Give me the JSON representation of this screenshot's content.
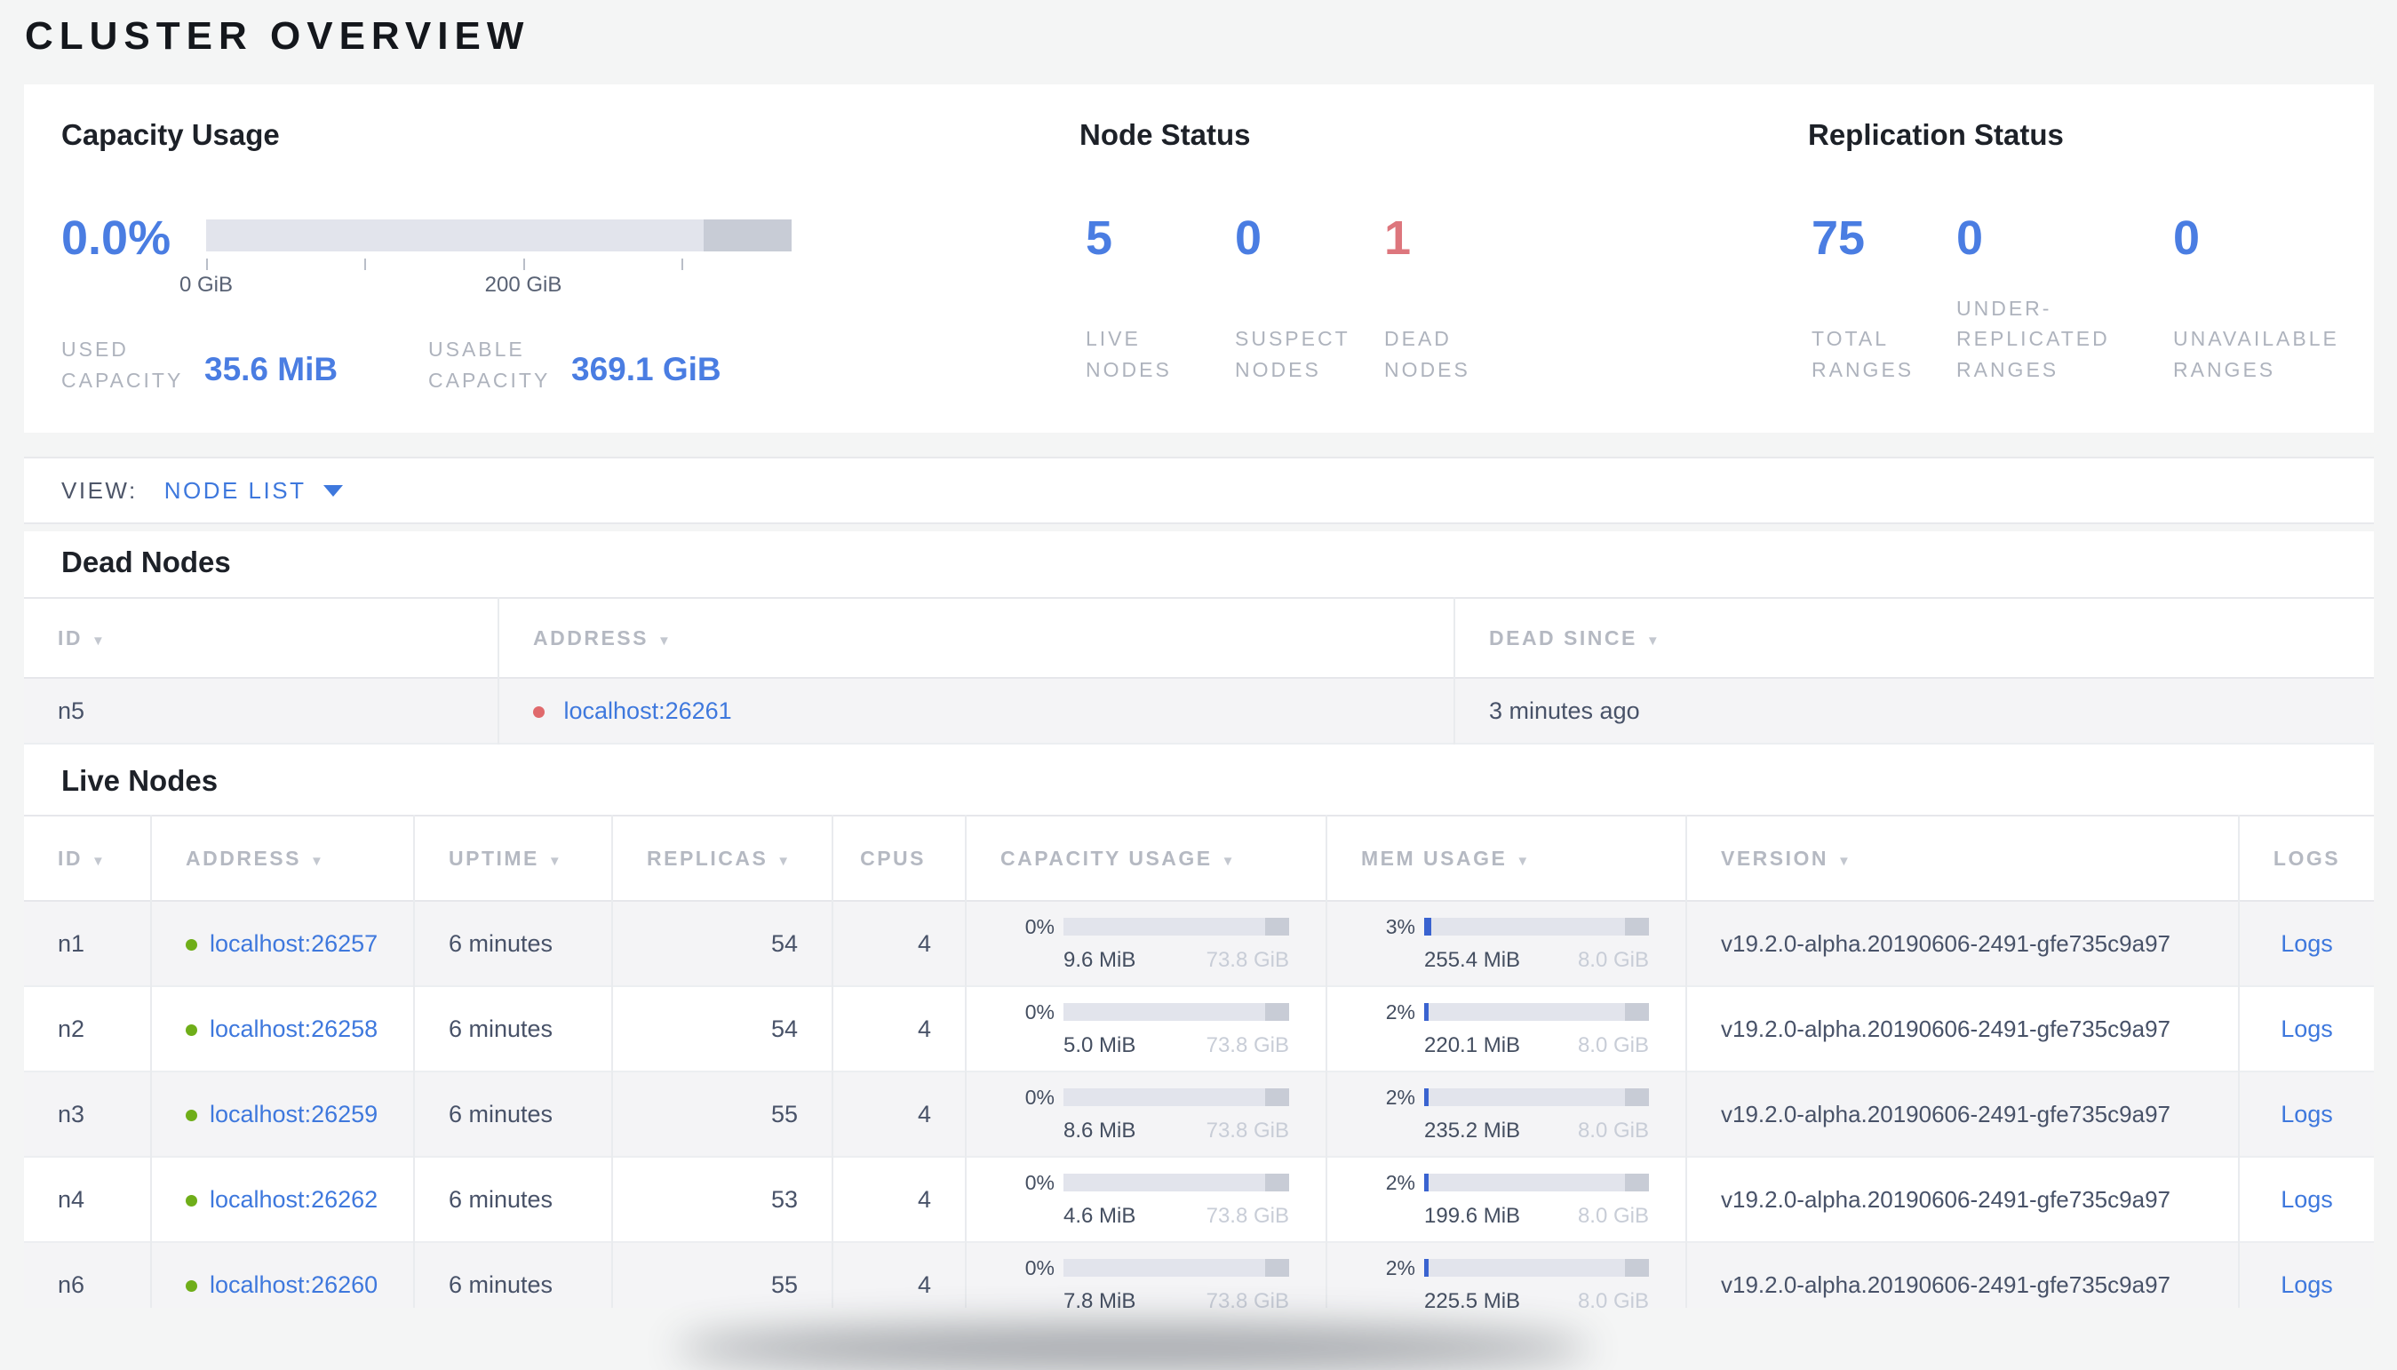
{
  "page_title": "CLUSTER OVERVIEW",
  "colors": {
    "accent_blue": "#3e78dd",
    "stat_blue": "#4a7de2",
    "dead_red": "#dd767d",
    "dead_dot": "#e0696c",
    "live_green": "#6fae19",
    "mem_fill": "#3a63d0"
  },
  "overview": {
    "capacity": {
      "title": "Capacity Usage",
      "percent": "0.0%",
      "tick_labels": [
        "0 GiB",
        "200 GiB"
      ],
      "used_label": "USED CAPACITY",
      "used_value": "35.6 MiB",
      "usable_label": "USABLE CAPACITY",
      "usable_value": "369.1 GiB"
    },
    "node_status": {
      "title": "Node Status",
      "stats": [
        {
          "value": "5",
          "label": "LIVE NODES"
        },
        {
          "value": "0",
          "label": "SUSPECT NODES"
        },
        {
          "value": "1",
          "label": "DEAD NODES"
        }
      ]
    },
    "replication": {
      "title": "Replication Status",
      "stats": [
        {
          "value": "75",
          "label": "TOTAL RANGES"
        },
        {
          "value": "0",
          "label": "UNDER-REPLICATED RANGES"
        },
        {
          "value": "0",
          "label": "UNAVAILABLE RANGES"
        }
      ]
    }
  },
  "view_bar": {
    "label": "VIEW:",
    "selected": "NODE LIST"
  },
  "dead_nodes": {
    "title": "Dead Nodes",
    "columns": [
      "ID",
      "ADDRESS",
      "DEAD SINCE"
    ],
    "rows": [
      {
        "id": "n5",
        "address": "localhost:26261",
        "dead_since": "3 minutes ago"
      }
    ]
  },
  "live_nodes": {
    "title": "Live Nodes",
    "columns": [
      "ID",
      "ADDRESS",
      "UPTIME",
      "REPLICAS",
      "CPUS",
      "CAPACITY USAGE",
      "MEM USAGE",
      "VERSION",
      "LOGS"
    ],
    "logs_label": "Logs",
    "rows": [
      {
        "id": "n1",
        "address": "localhost:26257",
        "uptime": "6 minutes",
        "replicas": "54",
        "cpus": "4",
        "capacity": {
          "percent": "0%",
          "used": "9.6 MiB",
          "total": "73.8 GiB"
        },
        "mem": {
          "percent": "3%",
          "used": "255.4 MiB",
          "total": "8.0 GiB"
        },
        "version": "v19.2.0-alpha.20190606-2491-gfe735c9a97"
      },
      {
        "id": "n2",
        "address": "localhost:26258",
        "uptime": "6 minutes",
        "replicas": "54",
        "cpus": "4",
        "capacity": {
          "percent": "0%",
          "used": "5.0 MiB",
          "total": "73.8 GiB"
        },
        "mem": {
          "percent": "2%",
          "used": "220.1 MiB",
          "total": "8.0 GiB"
        },
        "version": "v19.2.0-alpha.20190606-2491-gfe735c9a97"
      },
      {
        "id": "n3",
        "address": "localhost:26259",
        "uptime": "6 minutes",
        "replicas": "55",
        "cpus": "4",
        "capacity": {
          "percent": "0%",
          "used": "8.6 MiB",
          "total": "73.8 GiB"
        },
        "mem": {
          "percent": "2%",
          "used": "235.2 MiB",
          "total": "8.0 GiB"
        },
        "version": "v19.2.0-alpha.20190606-2491-gfe735c9a97"
      },
      {
        "id": "n4",
        "address": "localhost:26262",
        "uptime": "6 minutes",
        "replicas": "53",
        "cpus": "4",
        "capacity": {
          "percent": "0%",
          "used": "4.6 MiB",
          "total": "73.8 GiB"
        },
        "mem": {
          "percent": "2%",
          "used": "199.6 MiB",
          "total": "8.0 GiB"
        },
        "version": "v19.2.0-alpha.20190606-2491-gfe735c9a97"
      },
      {
        "id": "n6",
        "address": "localhost:26260",
        "uptime": "6 minutes",
        "replicas": "55",
        "cpus": "4",
        "capacity": {
          "percent": "0%",
          "used": "7.8 MiB",
          "total": "73.8 GiB"
        },
        "mem": {
          "percent": "2%",
          "used": "225.5 MiB",
          "total": "8.0 GiB"
        },
        "version": "v19.2.0-alpha.20190606-2491-gfe735c9a97"
      }
    ]
  }
}
